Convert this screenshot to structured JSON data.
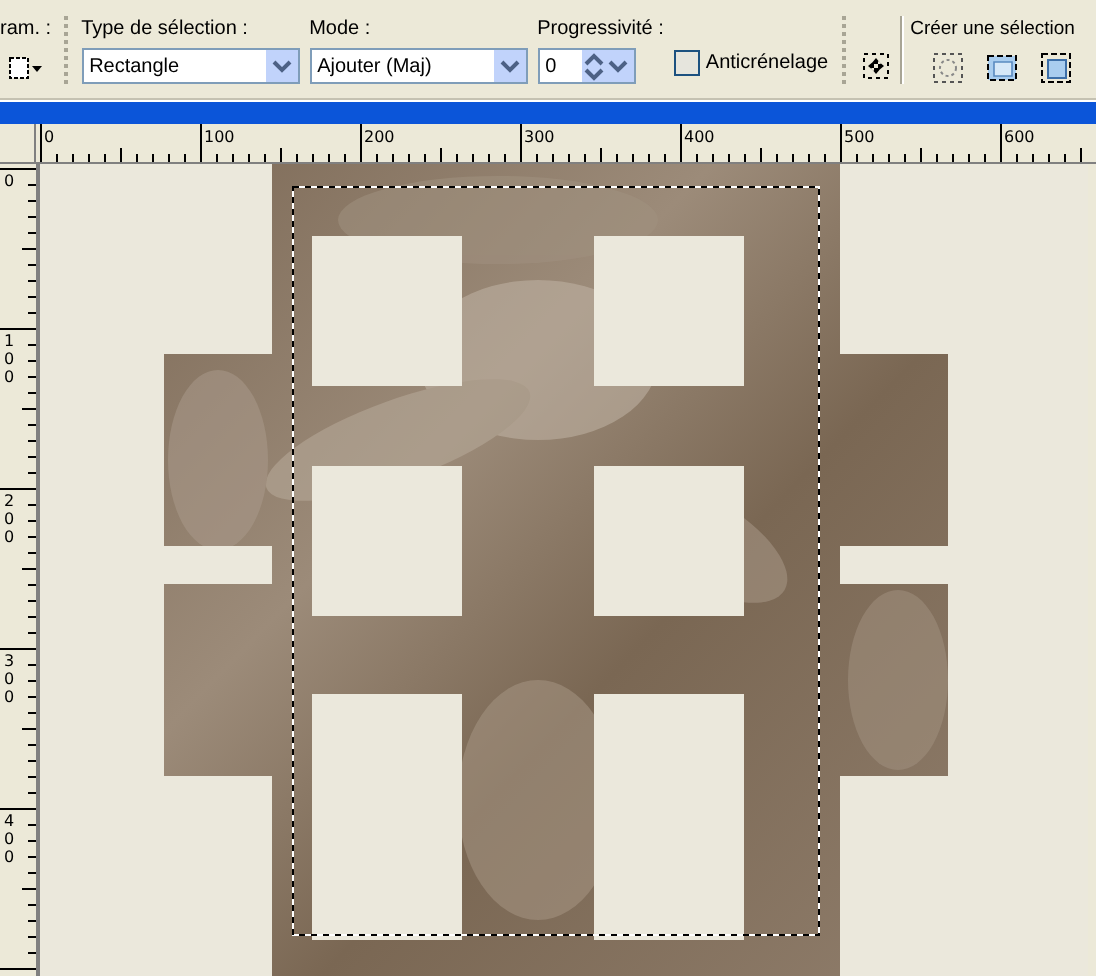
{
  "toolbar": {
    "param_label": "ram. :",
    "selection_type": {
      "label": "Type de sélection :",
      "value": "Rectangle"
    },
    "mode": {
      "label": "Mode :",
      "value": "Ajouter (Maj)"
    },
    "feather": {
      "label": "Progressivité :",
      "value": "0"
    },
    "antialias": {
      "label": "Anticrénelage",
      "checked": false
    },
    "create_selection": {
      "label": "Créer une sélection"
    }
  },
  "rulers": {
    "horizontal": [
      "0",
      "100",
      "200",
      "300",
      "400",
      "500",
      "600"
    ],
    "vertical": [
      "0",
      "100",
      "200",
      "300",
      "400"
    ]
  }
}
